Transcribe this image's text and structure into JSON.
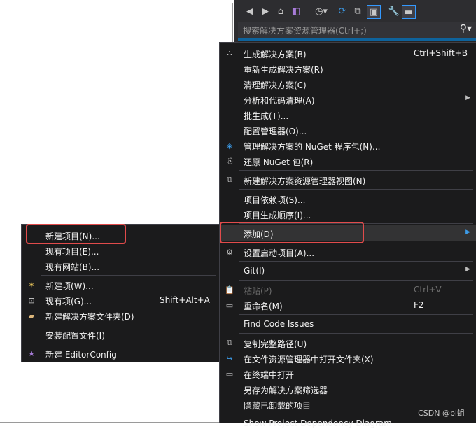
{
  "search": {
    "placeholder": "搜索解决方案资源管理器(Ctrl+;)"
  },
  "main_menu": {
    "build_solution": {
      "label": "生成解决方案(B)",
      "shortcut": "Ctrl+Shift+B"
    },
    "rebuild_solution": {
      "label": "重新生成解决方案(R)"
    },
    "clean_solution": {
      "label": "清理解决方案(C)"
    },
    "analyze_cleanup": {
      "label": "分析和代码清理(A)"
    },
    "batch_build": {
      "label": "批生成(T)..."
    },
    "config_manager": {
      "label": "配置管理器(O)..."
    },
    "manage_nuget": {
      "label": "管理解决方案的 NuGet 程序包(N)..."
    },
    "restore_nuget": {
      "label": "还原 NuGet 包(R)"
    },
    "new_explorer_view": {
      "label": "新建解决方案资源管理器视图(N)"
    },
    "project_deps": {
      "label": "项目依赖项(S)..."
    },
    "build_order": {
      "label": "项目生成顺序(I)..."
    },
    "add": {
      "label": "添加(D)"
    },
    "set_startup": {
      "label": "设置启动项目(A)..."
    },
    "git": {
      "label": "Git(I)"
    },
    "paste": {
      "label": "粘贴(P)",
      "shortcut": "Ctrl+V"
    },
    "rename": {
      "label": "重命名(M)",
      "shortcut": "F2"
    },
    "find_code_issues": {
      "label": "Find Code Issues"
    },
    "copy_full_path": {
      "label": "复制完整路径(U)"
    },
    "open_in_explorer": {
      "label": "在文件资源管理器中打开文件夹(X)"
    },
    "open_in_terminal": {
      "label": "在终端中打开"
    },
    "save_as_filter": {
      "label": "另存为解决方案筛选器"
    },
    "hide_unloaded": {
      "label": "隐藏已卸载的项目"
    },
    "show_dependency": {
      "label": "Show Project Dependency Diagram"
    }
  },
  "sub_menu": {
    "new_project": {
      "label": "新建项目(N)..."
    },
    "existing_project": {
      "label": "现有项目(E)..."
    },
    "existing_website": {
      "label": "现有网站(B)..."
    },
    "new_item": {
      "label": "新建项(W)..."
    },
    "existing_item": {
      "label": "现有项(G)...",
      "shortcut": "Shift+Alt+A"
    },
    "new_solution_folder": {
      "label": "新建解决方案文件夹(D)"
    },
    "install_config": {
      "label": "安装配置文件(I)"
    },
    "new_editorconfig": {
      "label": "新建 EditorConfig"
    }
  },
  "watermark": "CSDN @pi蛆",
  "colors": {
    "accent": "#0e639c",
    "highlight_box": "#e14b4b",
    "menu_bg": "#1b1b1c"
  }
}
